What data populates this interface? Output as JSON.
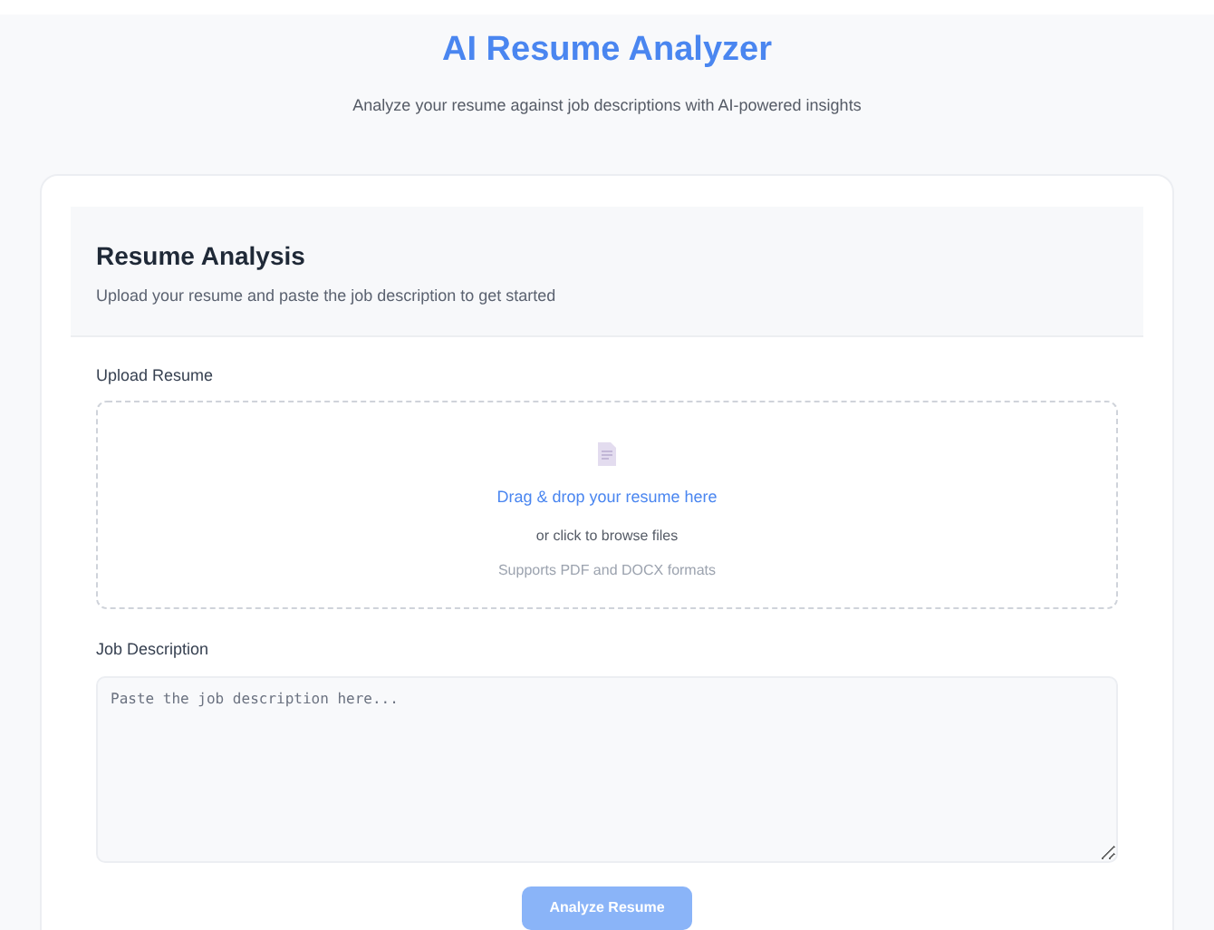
{
  "header": {
    "title": "AI Resume Analyzer",
    "subtitle": "Analyze your resume against job descriptions with AI-powered insights"
  },
  "card": {
    "title": "Resume Analysis",
    "subtitle": "Upload your resume and paste the job description to get started"
  },
  "upload": {
    "label": "Upload Resume",
    "prompt": "Drag & drop your resume here",
    "hint": "or click to browse files",
    "formats": "Supports PDF and DOCX formats"
  },
  "job_description": {
    "label": "Job Description",
    "placeholder": "Paste the job description here..."
  },
  "submit_button": {
    "label": "Analyze Resume",
    "disabled": true
  }
}
